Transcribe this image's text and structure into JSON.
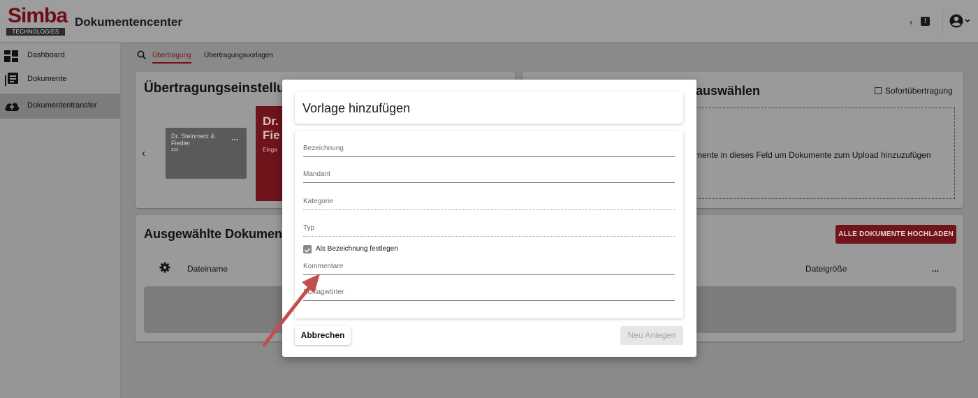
{
  "header": {
    "logo_word": "Simba",
    "logo_sub": "TECHNOLOGIES",
    "app_title": "Dokumentencenter",
    "prev_icon": "chevron-left",
    "notification_mark": "!",
    "account_icon": "account-circle-icon"
  },
  "sidebar": {
    "items": [
      {
        "label": "Dashboard",
        "icon": "dashboard-icon"
      },
      {
        "label": "Dokumente",
        "icon": "document-icon"
      },
      {
        "label": "Dokumententransfer",
        "icon": "cloud-upload-icon",
        "active": true
      }
    ]
  },
  "tabs": {
    "items": [
      {
        "label": "Übertragung",
        "active": true
      },
      {
        "label": "Übertragungsvorlagen"
      }
    ]
  },
  "settings_card": {
    "title": "Übertragungseinstellun",
    "tile1": {
      "name": "Dr. Steinmetz & Fiedler",
      "sub": "zzz",
      "more": "..."
    },
    "tile2": {
      "name": "Dr. Fie",
      "sub": "Einga"
    }
  },
  "upload_card": {
    "title": "auswählen",
    "instant_label": "Sofortübertragung",
    "drop_text": "mente in dieses Feld um Dokumente zum Upload hinzuzufügen"
  },
  "selected_card": {
    "title": "Ausgewählte Dokument",
    "upload_all_label": "ALLE DOKUMENTE HOCHLADEN",
    "col_name": "Dateiname",
    "col_size": "Dateigröße",
    "col_more": "..."
  },
  "modal": {
    "title": "Vorlage hinzufügen",
    "fields": [
      {
        "label": "Bezeichnung"
      },
      {
        "label": "Mandant"
      },
      {
        "label": "Kategorie"
      },
      {
        "label": "Typ"
      },
      {
        "label": "Kommentare"
      },
      {
        "label": "Schlagwörter"
      }
    ],
    "checkbox_label": "Als Bezeichnung festlegen",
    "checkbox_checked": true,
    "cancel_label": "Abbrechen",
    "create_label": "Neu Anlegen"
  },
  "colors": {
    "brand": "#6f141b",
    "overlay": "#8a8a8a",
    "annotation_arrow": "#c0504d"
  }
}
